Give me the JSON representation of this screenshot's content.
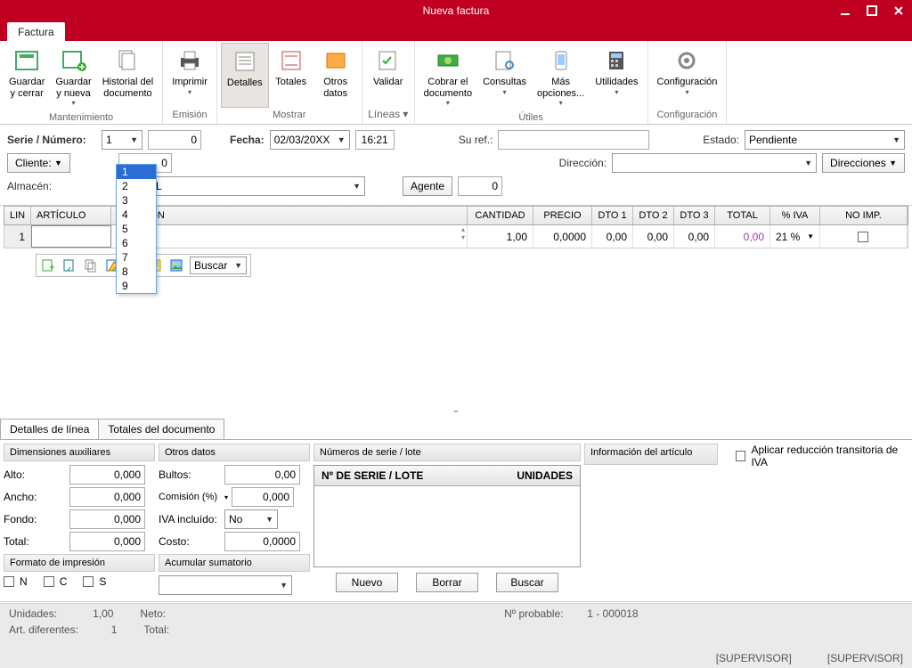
{
  "window": {
    "title": "Nueva factura"
  },
  "ribbon": {
    "tab": "Factura",
    "groups": {
      "mantenimiento": {
        "label": "Mantenimiento",
        "guardar_cerrar": "Guardar\ny cerrar",
        "guardar_nueva": "Guardar\ny nueva",
        "historial": "Historial del\ndocumento"
      },
      "emision": {
        "label": "Emisión",
        "imprimir": "Imprimir"
      },
      "mostrar": {
        "label": "Mostrar",
        "detalles": "Detalles",
        "totales": "Totales",
        "otros": "Otros\ndatos"
      },
      "lineas": {
        "label": "Líneas",
        "validar": "Validar"
      },
      "utiles": {
        "label": "Útiles",
        "cobrar": "Cobrar el\ndocumento",
        "consultas": "Consultas",
        "mas": "Más\nopciones...",
        "utilidades": "Utilidades"
      },
      "config": {
        "label": "Configuración",
        "configuracion": "Configuración"
      }
    }
  },
  "form": {
    "serie_numero_label": "Serie / Número:",
    "serie": "1",
    "numero": "0",
    "fecha_label": "Fecha:",
    "fecha": "02/03/20XX",
    "hora": "16:21",
    "su_ref_label": "Su ref.:",
    "estado_label": "Estado:",
    "estado": "Pendiente",
    "cliente_label": "Cliente:",
    "cliente_num": "0",
    "direccion_label": "Dirección:",
    "direcciones_btn": "Direcciones",
    "almacen_label": "Almacén:",
    "agente_btn": "Agente",
    "agente_num": "0",
    "dropdown": [
      "1",
      "2",
      "3",
      "4",
      "5",
      "6",
      "7",
      "8",
      "9"
    ]
  },
  "grid": {
    "headers": {
      "lin": "LIN",
      "articulo": "ARTÍCULO",
      "descripcion": "CRIPCIÓN",
      "cantidad": "CANTIDAD",
      "precio": "PRECIO",
      "dto1": "DTO 1",
      "dto2": "DTO 2",
      "dto3": "DTO 3",
      "total": "TOTAL",
      "iva": "% IVA",
      "noimp": "NO IMP."
    },
    "row": {
      "lin": "1",
      "cantidad": "1,00",
      "precio": "0,0000",
      "dto1": "0,00",
      "dto2": "0,00",
      "dto3": "0,00",
      "total": "0,00",
      "iva": "21 %"
    },
    "buscar": "Buscar"
  },
  "subtabs": {
    "detalles": "Detalles de línea",
    "totales": "Totales del documento"
  },
  "dim": {
    "header": "Dimensiones auxiliares",
    "alto": "Alto:",
    "ancho": "Ancho:",
    "fondo": "Fondo:",
    "total": "Total:",
    "v": "0,000",
    "formato_header": "Formato de impresión",
    "n": "N",
    "c": "C",
    "s": "S"
  },
  "otros": {
    "header": "Otros datos",
    "bultos": "Bultos:",
    "bultos_v": "0,00",
    "comision": "Comisión (%)",
    "comision_v": "0,000",
    "iva_incl": "IVA incluído:",
    "iva_v": "No",
    "costo": "Costo:",
    "costo_v": "0,0000",
    "acum_header": "Acumular sumatorio"
  },
  "serie": {
    "header": "Números de serie / lote",
    "col1": "Nº DE SERIE / LOTE",
    "col2": "UNIDADES",
    "nuevo": "Nuevo",
    "borrar": "Borrar",
    "buscar": "Buscar"
  },
  "info": {
    "header": "Información del artículo",
    "aplicar": "Aplicar reducción transitoria de IVA"
  },
  "status": {
    "unidades_l": "Unidades:",
    "unidades_v": "1,00",
    "neto_l": "Neto:",
    "art_l": "Art. diferentes:",
    "art_v": "1",
    "total_l": "Total:",
    "prob_l": "Nº probable:",
    "prob_v": "1 - 000018",
    "sup": "[SUPERVISOR]"
  }
}
